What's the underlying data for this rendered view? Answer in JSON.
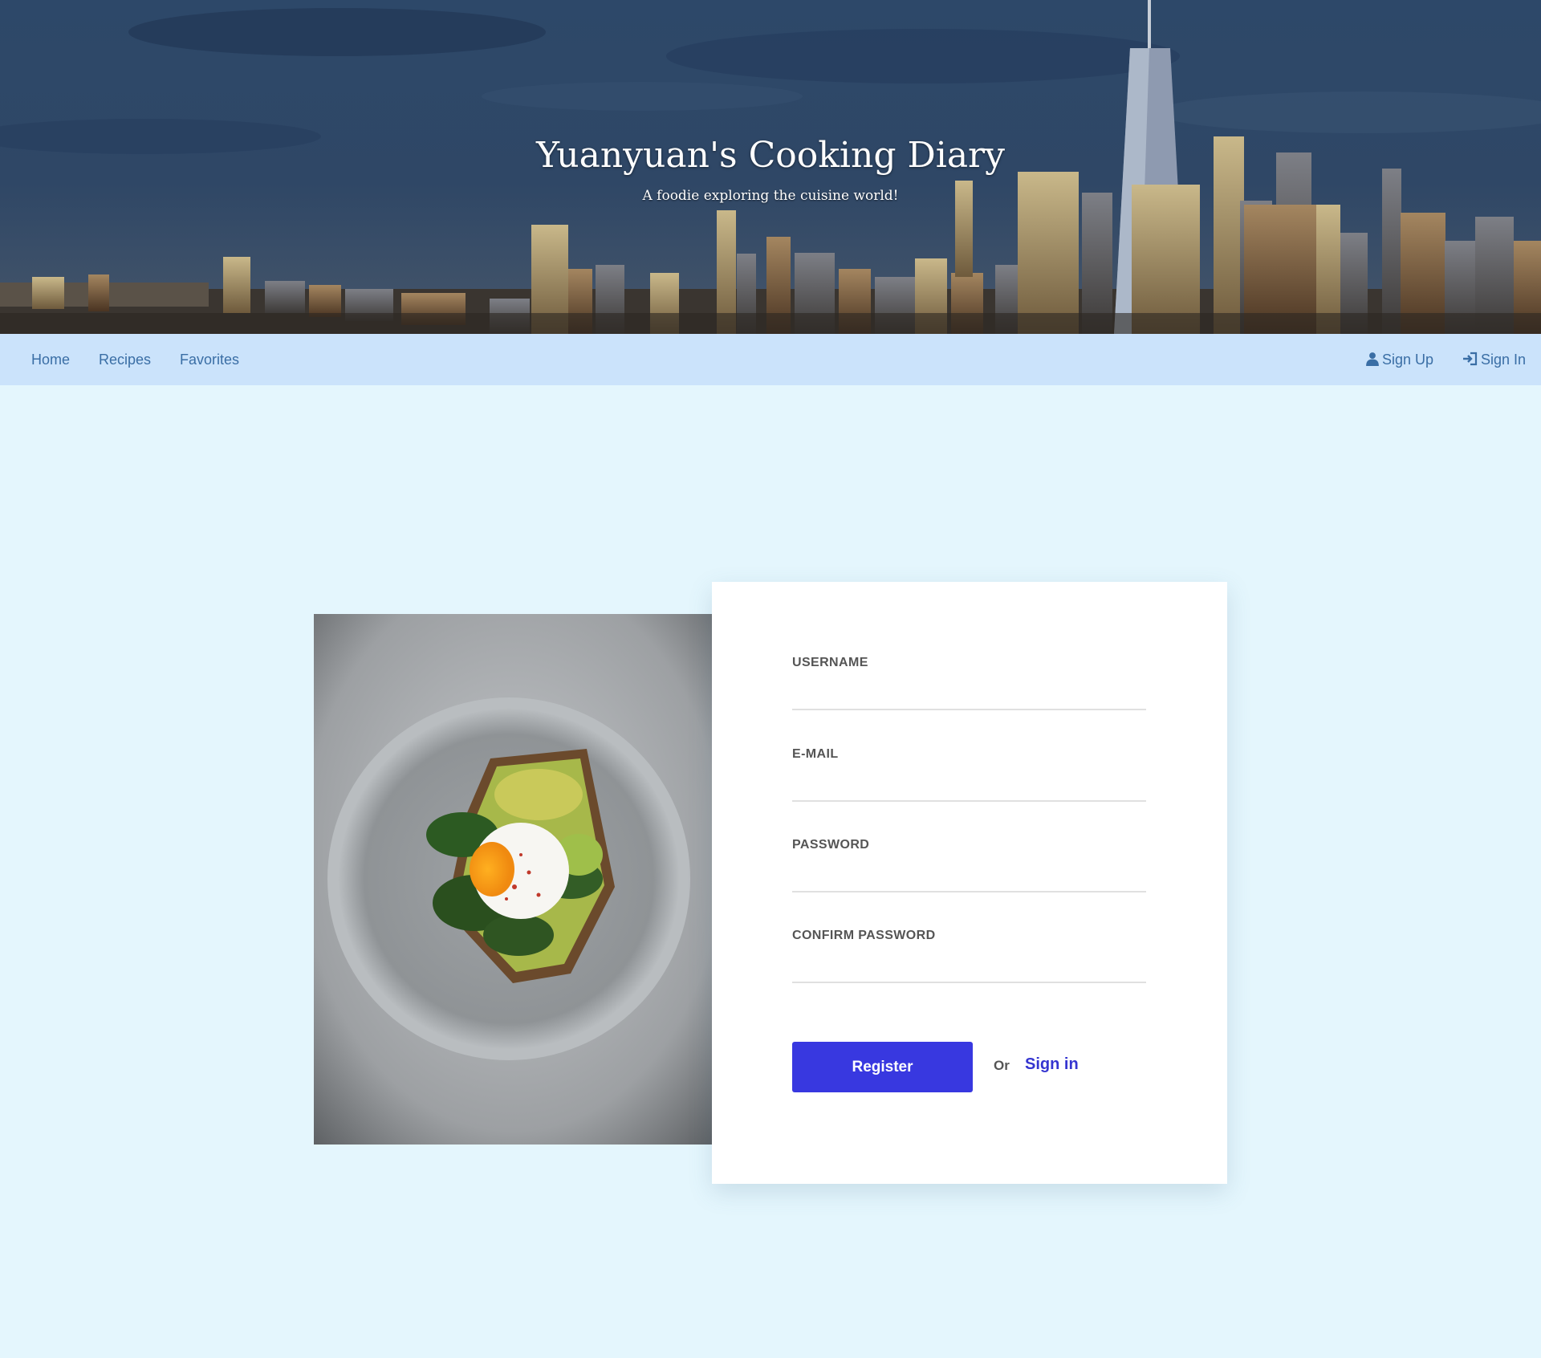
{
  "hero": {
    "title": "Yuanyuan's Cooking Diary",
    "subtitle": "A foodie exploring the cuisine world!"
  },
  "nav": {
    "left": [
      {
        "label": "Home"
      },
      {
        "label": "Recipes"
      },
      {
        "label": "Favorites"
      }
    ],
    "right": [
      {
        "label": "Sign Up",
        "icon": "user-icon"
      },
      {
        "label": "Sign In",
        "icon": "sign-in-icon"
      }
    ]
  },
  "form": {
    "fields": [
      {
        "label": "USERNAME",
        "value": ""
      },
      {
        "label": "E-MAIL",
        "value": ""
      },
      {
        "label": "PASSWORD",
        "value": ""
      },
      {
        "label": "CONFIRM PASSWORD",
        "value": ""
      }
    ],
    "register_label": "Register",
    "or_text": "Or",
    "signin_label": "Sign in"
  },
  "colors": {
    "page_bg": "#e4f6fd",
    "navbar_bg": "#cbe3fb",
    "nav_link": "#3a6ea5",
    "accent": "#3838e0",
    "card_bg": "#ffffff"
  }
}
